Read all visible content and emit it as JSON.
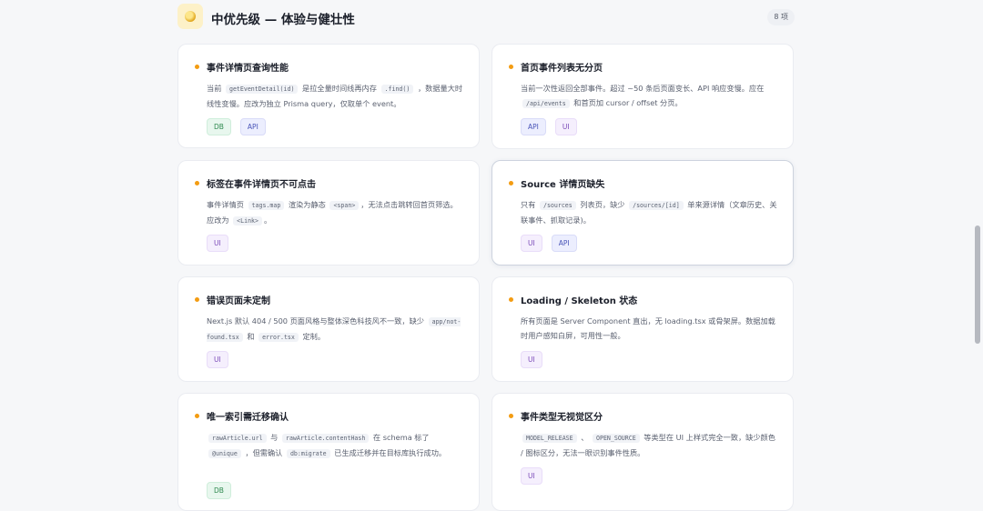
{
  "section": {
    "title": "中优先级 — 体验与健壮性",
    "count": "8 项",
    "icon": "coin-icon"
  },
  "cards": [
    {
      "title": "事件详情页查询性能",
      "desc": [
        {
          "t": "text",
          "v": "当前 "
        },
        {
          "t": "code",
          "v": "getEventDetail(id)"
        },
        {
          "t": "text",
          "v": " 是拉全量时间线再内存 "
        },
        {
          "t": "code",
          "v": ".find()"
        },
        {
          "t": "text",
          "v": " ，数据量大时线性变慢。应改为独立 Prisma query，仅取单个 event。"
        }
      ],
      "tags": [
        {
          "label": "DB",
          "kind": "db"
        },
        {
          "label": "API",
          "kind": "api"
        }
      ]
    },
    {
      "title": "首页事件列表无分页",
      "desc": [
        {
          "t": "text",
          "v": "当前一次性返回全部事件。超过 ~50 条后页面变长、API 响应变慢。应在 "
        },
        {
          "t": "code",
          "v": "/api/events"
        },
        {
          "t": "text",
          "v": " 和首页加 cursor / offset 分页。"
        }
      ],
      "tags": [
        {
          "label": "API",
          "kind": "api"
        },
        {
          "label": "UI",
          "kind": "ui"
        }
      ]
    },
    {
      "title": "标签在事件详情页不可点击",
      "desc": [
        {
          "t": "text",
          "v": "事件详情页 "
        },
        {
          "t": "code",
          "v": "tags.map"
        },
        {
          "t": "text",
          "v": " 渲染为静态 "
        },
        {
          "t": "code",
          "v": "<span>"
        },
        {
          "t": "text",
          "v": "，无法点击跳转回首页筛选。应改为 "
        },
        {
          "t": "code",
          "v": "<Link>"
        },
        {
          "t": "text",
          "v": "。"
        }
      ],
      "tags": [
        {
          "label": "UI",
          "kind": "ui"
        }
      ]
    },
    {
      "title": "Source 详情页缺失",
      "desc": [
        {
          "t": "text",
          "v": "只有 "
        },
        {
          "t": "code",
          "v": "/sources"
        },
        {
          "t": "text",
          "v": " 列表页，缺少 "
        },
        {
          "t": "code",
          "v": "/sources/[id]"
        },
        {
          "t": "text",
          "v": " 单来源详情（文章历史、关联事件、抓取记录)。"
        }
      ],
      "tags": [
        {
          "label": "UI",
          "kind": "ui"
        },
        {
          "label": "API",
          "kind": "api"
        }
      ]
    },
    {
      "title": "错误页面未定制",
      "desc": [
        {
          "t": "text",
          "v": "Next.js 默认 404 / 500 页面风格与整体深色科技风不一致，缺少 "
        },
        {
          "t": "code",
          "v": "app/not-found.tsx"
        },
        {
          "t": "text",
          "v": " 和 "
        },
        {
          "t": "code",
          "v": "error.tsx"
        },
        {
          "t": "text",
          "v": " 定制。"
        }
      ],
      "tags": [
        {
          "label": "UI",
          "kind": "ui"
        }
      ]
    },
    {
      "title": "Loading / Skeleton 状态",
      "desc": [
        {
          "t": "text",
          "v": "所有页面是 Server Component 直出，无 loading.tsx 或骨架屏。数据加载时用户感知白屏，可用性一般。"
        }
      ],
      "tags": [
        {
          "label": "UI",
          "kind": "ui"
        }
      ]
    },
    {
      "title": "唯一索引需迁移确认",
      "desc": [
        {
          "t": "code",
          "v": "rawArticle.url"
        },
        {
          "t": "text",
          "v": " 与 "
        },
        {
          "t": "code",
          "v": "rawArticle.contentHash"
        },
        {
          "t": "text",
          "v": " 在 schema 标了 "
        },
        {
          "t": "code",
          "v": "@unique"
        },
        {
          "t": "text",
          "v": " ，但需确认 "
        },
        {
          "t": "code",
          "v": "db:migrate"
        },
        {
          "t": "text",
          "v": " 已生成迁移并在目标库执行成功。"
        }
      ],
      "tags": [
        {
          "label": "DB",
          "kind": "db"
        }
      ]
    },
    {
      "title": "事件类型无视觉区分",
      "desc": [
        {
          "t": "code",
          "v": "MODEL_RELEASE"
        },
        {
          "t": "text",
          "v": " 、 "
        },
        {
          "t": "code",
          "v": "OPEN_SOURCE"
        },
        {
          "t": "text",
          "v": " 等类型在 UI 上样式完全一致，缺少颜色 / 图标区分，无法一眼识别事件性质。"
        }
      ],
      "tags": [
        {
          "label": "UI",
          "kind": "ui"
        }
      ]
    }
  ]
}
